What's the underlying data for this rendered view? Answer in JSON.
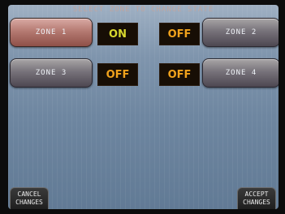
{
  "screen": {
    "title": "SELECT ZONE TO CHANGE STATE"
  },
  "zones": [
    {
      "label": "ZONE 1",
      "state": "ON"
    },
    {
      "label": "ZONE 2",
      "state": "OFF"
    },
    {
      "label": "ZONE 3",
      "state": "OFF"
    },
    {
      "label": "ZONE 4",
      "state": "OFF"
    }
  ],
  "actions": {
    "cancel_line1": "CANCEL",
    "cancel_line2": "CHANGES",
    "accept_line1": "ACCEPT",
    "accept_line2": "CHANGES"
  },
  "colors": {
    "state_on": "#d8d82e",
    "state_off": "#f0a21c"
  }
}
